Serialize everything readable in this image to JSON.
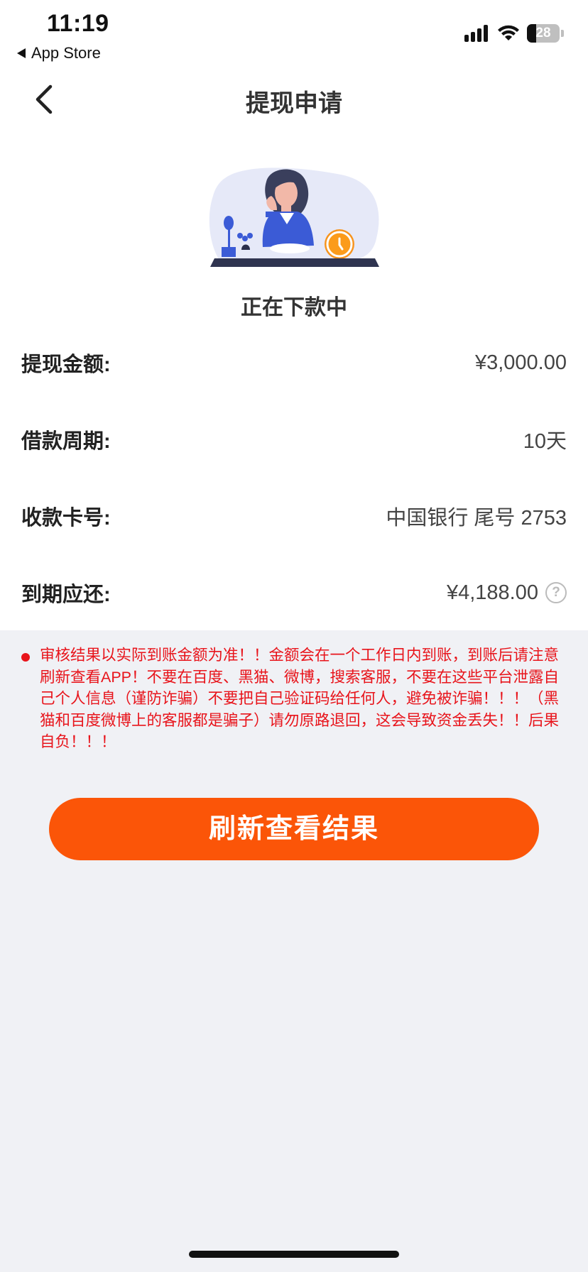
{
  "status_bar": {
    "time": "11:19",
    "back_app": "App Store",
    "battery": "28"
  },
  "nav": {
    "title": "提现申请"
  },
  "loan_status": "正在下款中",
  "details": [
    {
      "label": "提现金额:",
      "value": "¥3,000.00"
    },
    {
      "label": "借款周期:",
      "value": "10天"
    },
    {
      "label": "收款卡号:",
      "value": "中国银行 尾号 2753"
    },
    {
      "label": "到期应还:",
      "value": "¥4,188.00"
    }
  ],
  "notice": "审核结果以实际到账金额为准！！金额会在一个工作日内到账，到账后请注意刷新查看APP！不要在百度、黑猫、微博，搜索客服，不要在这些平台泄露自己个人信息（谨防诈骗）不要把自己验证码给任何人，避免被诈骗！！！（黑猫和百度微博上的客服都是骗子）请勿原路退回，这会导致资金丢失！！后果自负！！！",
  "button": {
    "label": "刷新查看结果"
  },
  "colors": {
    "accent": "#fb5508",
    "warning": "#e8141b",
    "background": "#f0f1f5"
  },
  "icons": {
    "back": "chevron-left-icon",
    "help": "question-circle-icon"
  }
}
